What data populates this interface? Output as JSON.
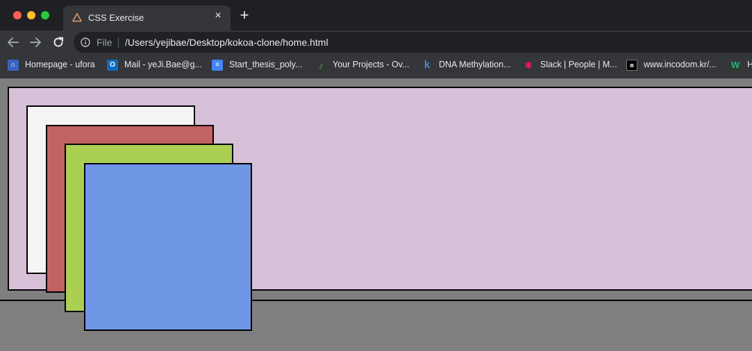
{
  "tab": {
    "title": "CSS Exercise",
    "close": "×"
  },
  "new_tab": "+",
  "address": {
    "scheme_label": "File",
    "url": "/Users/yejibae/Desktop/kokoa-clone/home.html"
  },
  "bookmarks": [
    {
      "label": "Homepage - ufora",
      "icon": "bank-icon",
      "color": "#3b63c4"
    },
    {
      "label": "Mail - yeJi.Bae@g...",
      "icon": "outlook-icon",
      "color": "#0f6cbd"
    },
    {
      "label": "Start_thesis_poly...",
      "icon": "docs-icon",
      "color": "#4285f4"
    },
    {
      "label": "Your Projects - Ov...",
      "icon": "overleaf-icon",
      "color": "#47a141"
    },
    {
      "label": "DNA Methylation...",
      "icon": "k-icon",
      "color": "#3c8fd6"
    },
    {
      "label": "Slack | People | M...",
      "icon": "slack-icon",
      "color": "#e01e5a"
    },
    {
      "label": "www.incodom.kr/...",
      "icon": "incodom-icon",
      "color": "#000000"
    },
    {
      "label": "H",
      "icon": "w-icon",
      "color": "#2bb673"
    }
  ],
  "colors": {
    "page_bg": "#7f7f7f",
    "container_bg": "#d6c1d9",
    "box1": "#f5f5f5",
    "box2": "#c26262",
    "box3": "#aacf53",
    "box4": "#6f97e6"
  }
}
